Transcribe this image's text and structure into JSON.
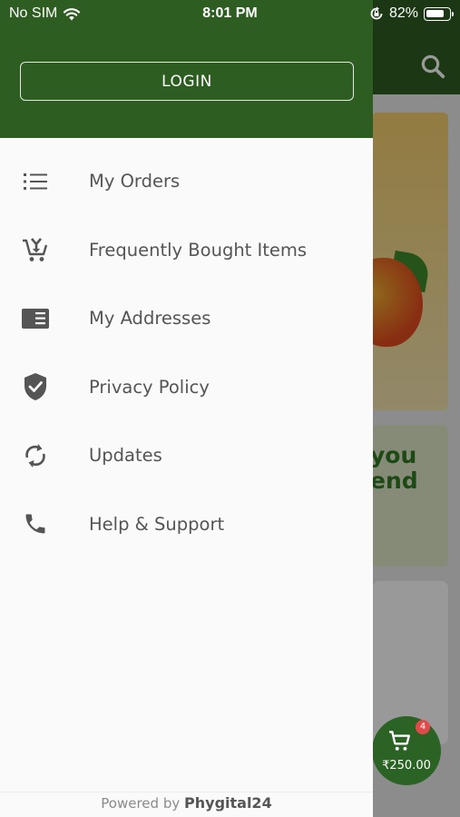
{
  "status_bar": {
    "carrier": "No SIM",
    "time": "8:01 PM",
    "battery_percent": "82%",
    "battery_level": 0.82
  },
  "drawer": {
    "login_label": "LOGIN",
    "menu": [
      {
        "label": "My Orders",
        "icon": "list-icon"
      },
      {
        "label": "Frequently Bought Items",
        "icon": "cart-add-icon"
      },
      {
        "label": "My Addresses",
        "icon": "address-card-icon"
      },
      {
        "label": "Privacy Policy",
        "icon": "shield-check-icon"
      },
      {
        "label": "Updates",
        "icon": "refresh-icon"
      },
      {
        "label": "Help & Support",
        "icon": "phone-icon"
      }
    ],
    "footer": {
      "prefix": "Powered by",
      "brand": "Phygital24"
    }
  },
  "background": {
    "promo_text_line1": "you",
    "promo_text_line2": "end",
    "cart_badge": "4",
    "cart_total": "₹250.00"
  },
  "colors": {
    "header_green": "#2d5d20",
    "fab_green": "#2a6323",
    "badge_red": "#e14a4a",
    "menu_text": "#555555"
  }
}
